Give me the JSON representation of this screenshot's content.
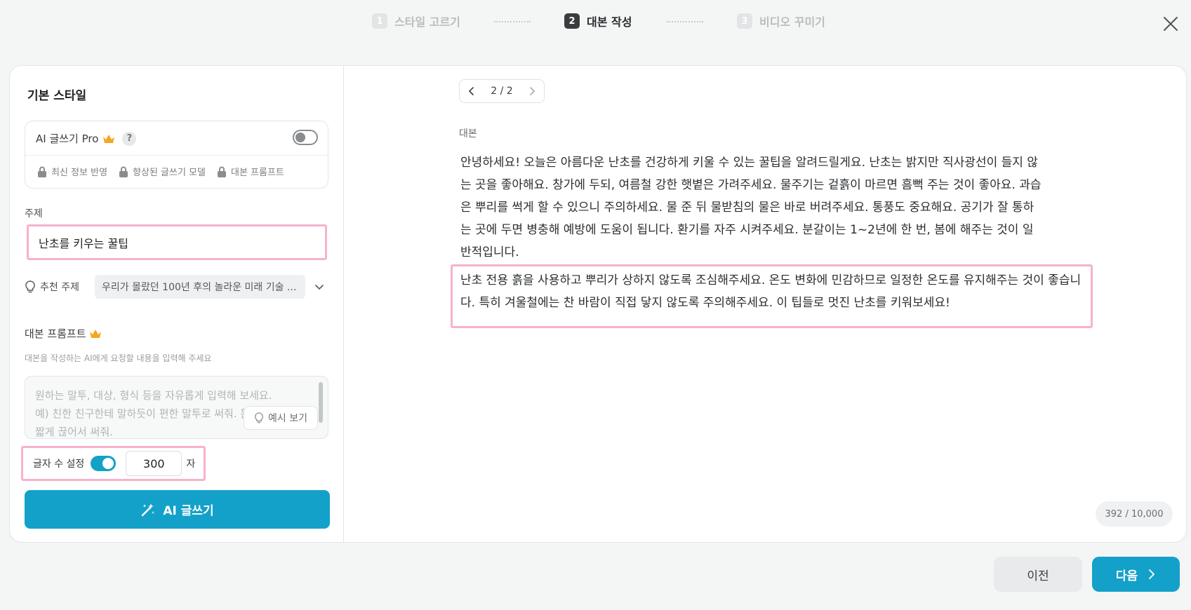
{
  "stepper": {
    "steps": [
      {
        "num": "1",
        "label": "스타일 고르기",
        "state": "inactive"
      },
      {
        "num": "2",
        "label": "대본 작성",
        "state": "active"
      },
      {
        "num": "3",
        "label": "비디오 꾸미기",
        "state": "inactive"
      }
    ]
  },
  "left": {
    "section_title": "기본 스타일",
    "ai_pro": {
      "label": "AI 글쓰기 Pro",
      "help": "?",
      "toggle_on": false,
      "features": [
        "최신 정보 반영",
        "향상된 글쓰기 모델",
        "대본 프롬프트"
      ]
    },
    "topic": {
      "label": "주제",
      "value": "난초를 키우는 꿀팁"
    },
    "recommended": {
      "label": "추천 주제",
      "value": "우리가 몰랐던 100년 후의 놀라운 미래 기술 ..."
    },
    "prompt": {
      "title": "대본 프롬프트",
      "description": "대본을 작성하는 AI에게 요청할 내용을 입력해 주세요",
      "placeholder": "원하는 말투, 대상, 형식 등을 자유롭게 입력해 보세요. 예) 친한 친구한테 말하듯이 편한 말투로 써줘. 문장은 짧게 끊어서 써줘.",
      "example_button": "예시 보기"
    },
    "char_setting": {
      "label": "글자 수 설정",
      "toggle_on": true,
      "value": "300",
      "unit": "자"
    },
    "ai_write_button": "AI 글쓰기"
  },
  "right": {
    "pager": "2 / 2",
    "script_label": "대본",
    "paragraph_1": "안녕하세요! 오늘은 아름다운 난초를 건강하게 키울 수 있는 꿀팁을 알려드릴게요. 난초는 밝지만 직사광선이 들지 않는 곳을 좋아해요. 창가에 두되, 여름철 강한 햇볕은 가려주세요. 물주기는 겉흙이 마르면 흠뻑 주는 것이 좋아요. 과습은 뿌리를 썩게 할 수 있으니 주의하세요. 물 준 뒤 물받침의 물은 바로 버려주세요. 통풍도 중요해요. 공기가 잘 통하는 곳에 두면 병충해 예방에 도움이 됩니다. 환기를 자주 시켜주세요. 분갈이는 1~2년에 한 번, 봄에 해주는 것이 일반적입니다.",
    "paragraph_2": "난초 전용 흙을 사용하고 뿌리가 상하지 않도록 조심해주세요. 온도 변화에 민감하므로 일정한 온도를 유지해주는 것이 좋습니다. 특히 겨울철에는 찬 바람이 직접 닿지 않도록 주의해주세요. 이 팁들로 멋진 난초를 키워보세요!",
    "char_count": "392 / 10,000"
  },
  "footer": {
    "prev": "이전",
    "next": "다음"
  },
  "colors": {
    "accent": "#13a1c9",
    "highlight": "#f7b1cf",
    "crown": "#f5a623"
  }
}
